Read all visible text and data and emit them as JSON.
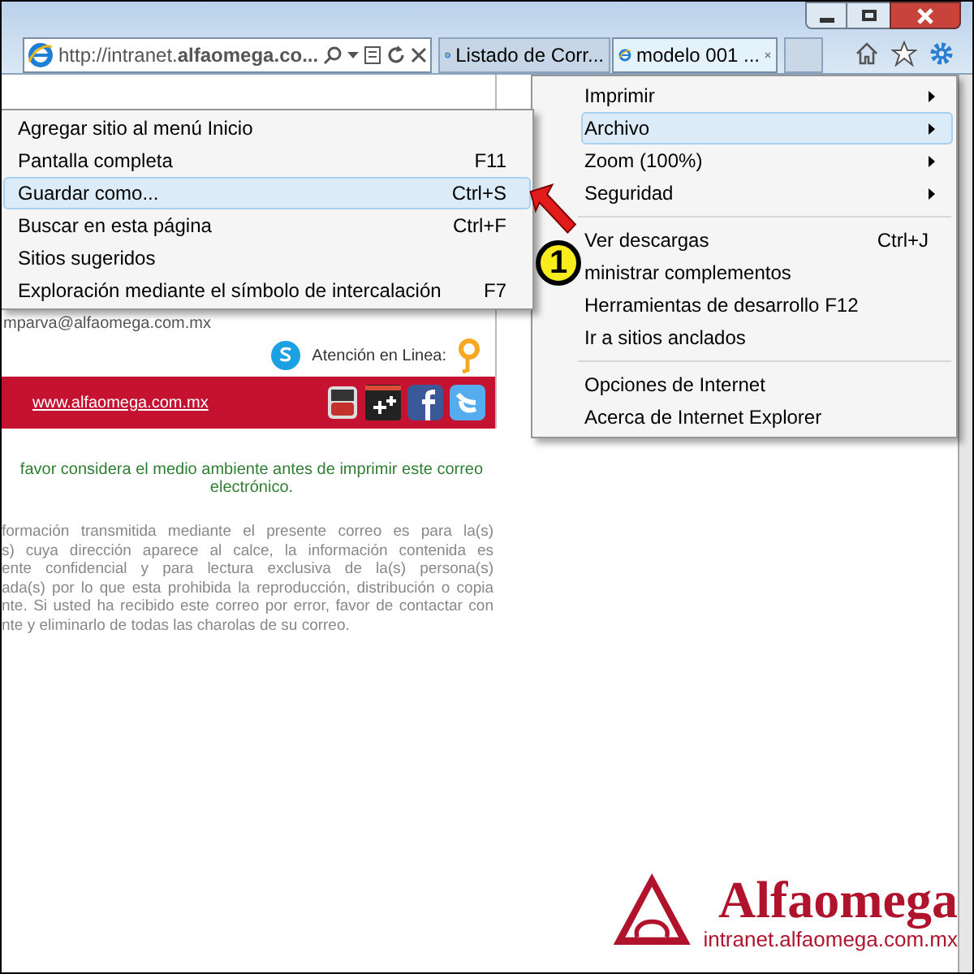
{
  "address_bar": {
    "url": "http://intranet.**alfaomega.co...**"
  },
  "tabs": [
    {
      "label": "Listado de Corr...",
      "selected": false,
      "closable": false
    },
    {
      "label": "modelo 001 ...",
      "selected": true,
      "closable": true
    }
  ],
  "tools_menu": {
    "groups": [
      [
        {
          "label": "Imprimir",
          "submenu": true,
          "selected": false
        },
        {
          "label": "Archivo",
          "submenu": true,
          "selected": true
        },
        {
          "label": "Zoom (100%)",
          "submenu": true,
          "selected": false
        },
        {
          "label": "Seguridad",
          "submenu": true,
          "selected": false
        }
      ],
      [
        {
          "label": "Ver descargas",
          "shortcut": "Ctrl+J",
          "submenu": false,
          "selected": false
        },
        {
          "label": "ministrar complementos",
          "submenu": false,
          "selected": false
        },
        {
          "label": "Herramientas de desarrollo F12",
          "submenu": false,
          "selected": false
        },
        {
          "label": "Ir a sitios anclados",
          "submenu": false,
          "selected": false
        }
      ],
      [
        {
          "label": "Opciones de Internet",
          "submenu": false,
          "selected": false
        },
        {
          "label": "Acerca de Internet Explorer",
          "submenu": false,
          "selected": false
        }
      ]
    ]
  },
  "file_submenu": {
    "items": [
      {
        "label": "Agregar sitio al menú Inicio",
        "selected": false
      },
      {
        "label": "Pantalla completa",
        "shortcut": "F11",
        "selected": false
      },
      {
        "label": "Guardar como...",
        "shortcut": "Ctrl+S",
        "selected": true
      },
      {
        "label": "Buscar en esta página",
        "shortcut": "Ctrl+F",
        "selected": false
      },
      {
        "label": "Sitios sugeridos",
        "selected": false
      },
      {
        "label": "Exploración mediante el símbolo de intercalación",
        "shortcut": "F7",
        "selected": false
      }
    ]
  },
  "email": {
    "contact": "mparva@alfaomega.com.mx",
    "online_label": "Atención en Linea:",
    "footer_link": "www.alfaomega.com.mx",
    "eco_note": [
      "favor considera el medio ambiente antes de imprimir este correo",
      "electrónico."
    ],
    "disclaimer": [
      "formación transmitida mediante el presente correo es para la(s)",
      "s) cuya dirección aparece al calce, la información contenida es",
      "ente confidencial y para lectura exclusiva de la(s) persona(s)",
      "ada(s) por lo que esta prohibida la reproducción, distribución o copia",
      "nte. Si usted ha recibido este correo por error, favor de contactar con",
      "nte y eliminarlo de todas las charolas de su correo."
    ]
  },
  "callout": {
    "number": "1"
  },
  "brand": {
    "name": "Alfaomega",
    "url": "intranet.alfaomega.com.mx"
  }
}
